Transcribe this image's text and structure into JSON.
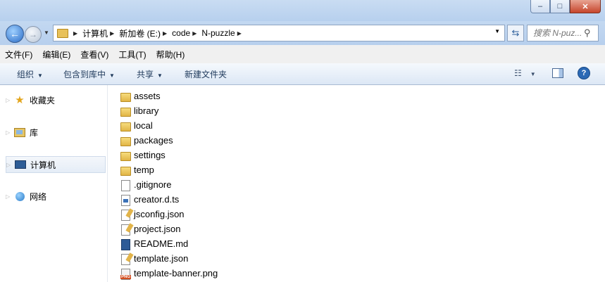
{
  "window": {
    "min_icon": "minimize-icon",
    "max_icon": "maximize-icon",
    "close_icon": "close-icon",
    "min_glyph": "–",
    "max_glyph": "□",
    "close_glyph": "✕"
  },
  "address": {
    "crumbs": [
      "计算机",
      "新加卷 (E:)",
      "code",
      "N-puzzle"
    ],
    "search_placeholder": "搜索 N-puz..."
  },
  "menu": [
    "文件(F)",
    "编辑(E)",
    "查看(V)",
    "工具(T)",
    "帮助(H)"
  ],
  "toolbar": {
    "organize": "组织",
    "include_library": "包含到库中",
    "share": "共享",
    "new_folder": "新建文件夹",
    "help_glyph": "?"
  },
  "nav": [
    {
      "label": "收藏夹",
      "icon": "star-icon"
    },
    {
      "label": "库",
      "icon": "library-icon"
    },
    {
      "label": "计算机",
      "icon": "computer-icon"
    },
    {
      "label": "网络",
      "icon": "network-icon"
    }
  ],
  "files": [
    {
      "name": "assets",
      "type": "folder"
    },
    {
      "name": "library",
      "type": "folder"
    },
    {
      "name": "local",
      "type": "folder"
    },
    {
      "name": "packages",
      "type": "folder"
    },
    {
      "name": "settings",
      "type": "folder"
    },
    {
      "name": "temp",
      "type": "folder"
    },
    {
      "name": ".gitignore",
      "type": "file"
    },
    {
      "name": "creator.d.ts",
      "type": "ts"
    },
    {
      "name": "jsconfig.json",
      "type": "json"
    },
    {
      "name": "project.json",
      "type": "json"
    },
    {
      "name": "README.md",
      "type": "md"
    },
    {
      "name": "template.json",
      "type": "json"
    },
    {
      "name": "template-banner.png",
      "type": "png"
    }
  ]
}
